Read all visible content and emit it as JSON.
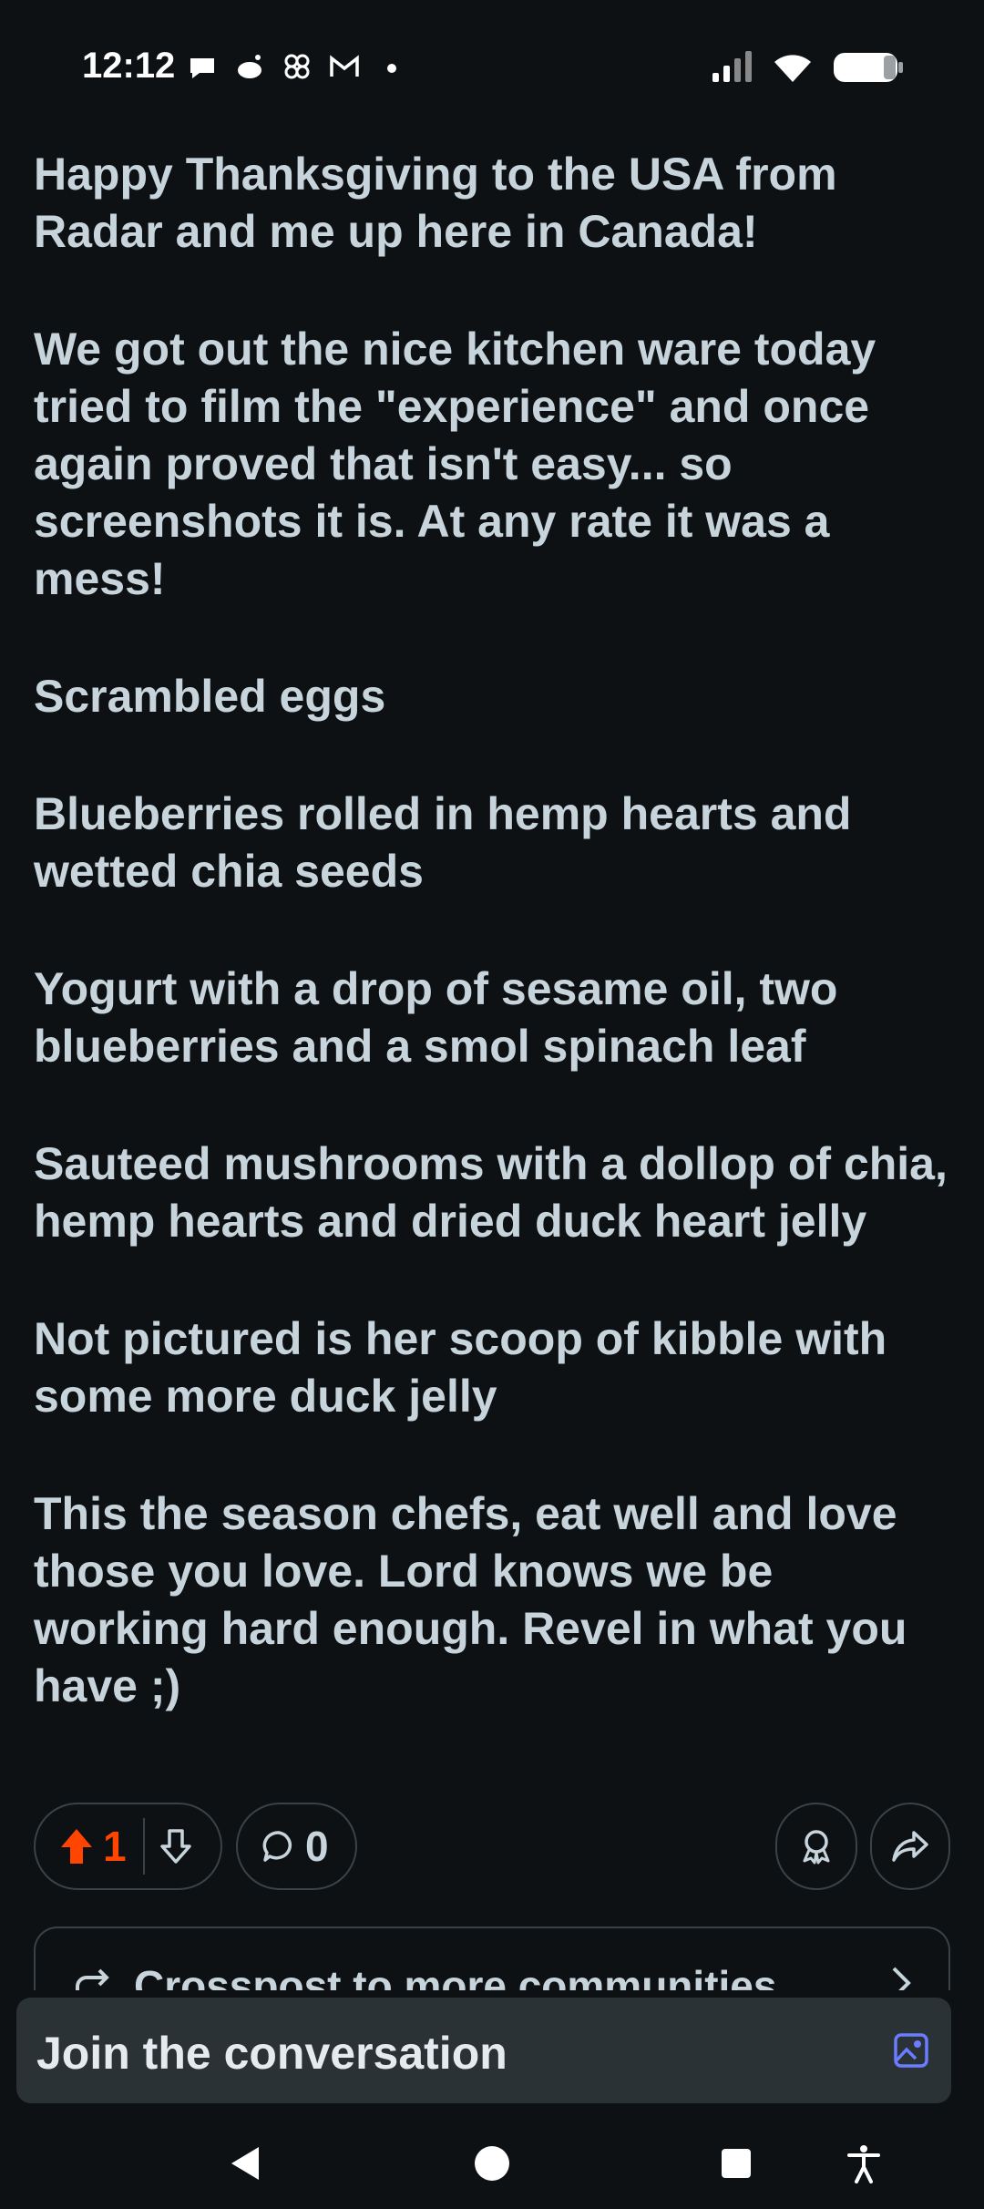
{
  "status_bar": {
    "time": "12:12",
    "notification_icons": [
      "chat-bubble-icon",
      "reddit-icon",
      "pinwheel-icon",
      "gmail-icon",
      "dot-icon"
    ],
    "system_icons": [
      "signal-icon",
      "wifi-icon",
      "battery-icon"
    ]
  },
  "post": {
    "paragraphs": [
      "Happy Thanksgiving to the USA from Radar and me up here in Canada!",
      "We got out the nice kitchen ware today tried to film the \"experience\" and once again proved that isn't easy... so screenshots it is. At any rate it was a mess!",
      "Scrambled eggs",
      "Blueberries rolled in hemp hearts and wetted chia seeds",
      "Yogurt with a drop of sesame oil, two blueberries and a smol spinach leaf",
      "Sauteed mushrooms with a dollop of chia, hemp hearts and dried duck heart jelly",
      "Not pictured is her scoop of kibble with some more duck jelly",
      "This the season chefs, eat well and love those you love. Lord knows we be working hard enough. Revel in what you have ;)"
    ]
  },
  "actions": {
    "upvote_count": "1",
    "comment_count": "0",
    "upvote_color": "#ff4500"
  },
  "crosspost": {
    "label": "Crosspost to more communities"
  },
  "composer": {
    "placeholder": "Join the conversation",
    "accent": "#6a7cff"
  },
  "navbar": {
    "buttons": [
      "back-icon",
      "home-icon",
      "recents-icon",
      "accessibility-icon"
    ]
  }
}
